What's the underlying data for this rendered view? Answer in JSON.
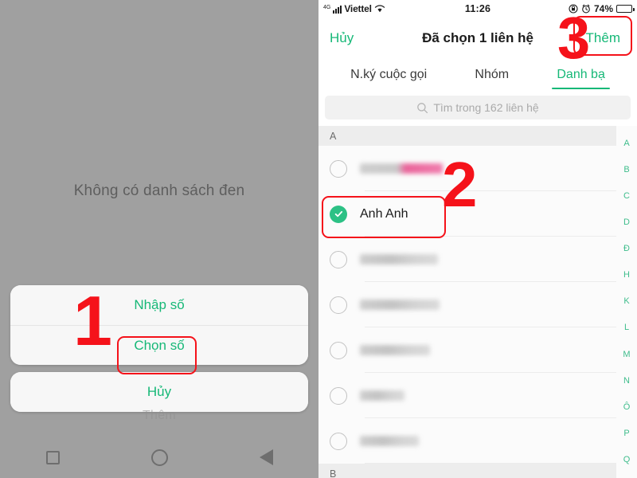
{
  "left_screen": {
    "empty_state_text": "Không có danh sách đen",
    "action_sheet": {
      "items": [
        {
          "label": "Nhập số"
        },
        {
          "label": "Chọn số"
        }
      ],
      "cancel_label": "Hủy",
      "ghost_label": "Thêm"
    },
    "nav_bar": {
      "recents": "square-icon",
      "home": "circle-icon",
      "back": "triangle-back-icon"
    }
  },
  "right_screen": {
    "status_bar": {
      "network_type": "4G",
      "carrier": "Viettel",
      "wifi": "wifi-icon",
      "time": "11:26",
      "rotation_lock": "rotation-lock-icon",
      "alarm": "alarm-icon",
      "battery_percent": "74%",
      "battery_level": 74
    },
    "header": {
      "cancel_label": "Hủy",
      "title": "Đã chọn 1 liên hệ",
      "add_label": "Thêm"
    },
    "tabs": [
      {
        "label": "N.ký cuộc gọi",
        "active": false
      },
      {
        "label": "Nhóm",
        "active": false
      },
      {
        "label": "Danh bạ",
        "active": true
      }
    ],
    "search": {
      "placeholder": "Tìm trong 162 liên hệ",
      "icon": "search-icon",
      "value": ""
    },
    "sections": [
      {
        "letter": "A",
        "contacts": [
          {
            "name": "",
            "redacted": true,
            "accent": "pink",
            "selected": false
          },
          {
            "name": "Anh Anh",
            "redacted": false,
            "accent": "none",
            "selected": true
          },
          {
            "name": "",
            "redacted": true,
            "accent": "none",
            "selected": false
          },
          {
            "name": "",
            "redacted": true,
            "accent": "none",
            "selected": false
          },
          {
            "name": "",
            "redacted": true,
            "accent": "none",
            "selected": false
          },
          {
            "name": "",
            "redacted": true,
            "accent": "none",
            "selected": false
          },
          {
            "name": "",
            "redacted": true,
            "accent": "none",
            "selected": false
          }
        ]
      },
      {
        "letter": "B",
        "contacts": []
      }
    ],
    "alpha_index": [
      "A",
      "B",
      "C",
      "D",
      "Đ",
      "H",
      "K",
      "L",
      "M",
      "N",
      "Ô",
      "P",
      "Q"
    ]
  },
  "annotations": [
    {
      "number": "1",
      "target": "chon-so-button"
    },
    {
      "number": "2",
      "target": "selected-contact-anh-anh"
    },
    {
      "number": "3",
      "target": "them-button"
    }
  ],
  "colors": {
    "brand_green": "#16b877",
    "check_green": "#2cc185",
    "annotation_red": "#f5121a",
    "dim_overlay": "#a0a0a0"
  }
}
